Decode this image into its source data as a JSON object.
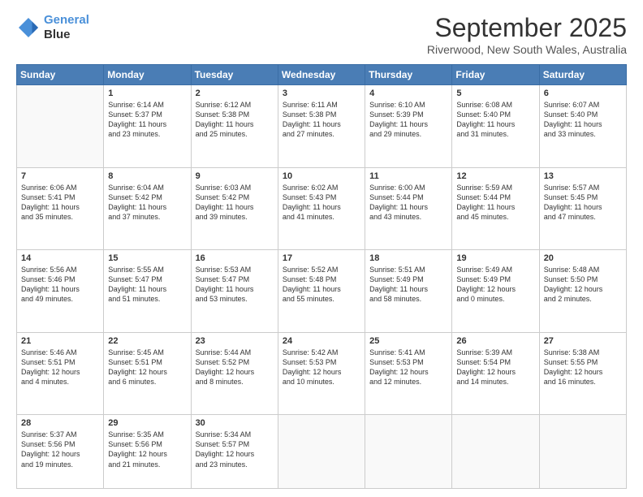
{
  "logo": {
    "line1": "General",
    "line2": "Blue"
  },
  "title": "September 2025",
  "subtitle": "Riverwood, New South Wales, Australia",
  "days_header": [
    "Sunday",
    "Monday",
    "Tuesday",
    "Wednesday",
    "Thursday",
    "Friday",
    "Saturday"
  ],
  "weeks": [
    [
      {
        "day": "",
        "content": ""
      },
      {
        "day": "1",
        "content": "Sunrise: 6:14 AM\nSunset: 5:37 PM\nDaylight: 11 hours\nand 23 minutes."
      },
      {
        "day": "2",
        "content": "Sunrise: 6:12 AM\nSunset: 5:38 PM\nDaylight: 11 hours\nand 25 minutes."
      },
      {
        "day": "3",
        "content": "Sunrise: 6:11 AM\nSunset: 5:38 PM\nDaylight: 11 hours\nand 27 minutes."
      },
      {
        "day": "4",
        "content": "Sunrise: 6:10 AM\nSunset: 5:39 PM\nDaylight: 11 hours\nand 29 minutes."
      },
      {
        "day": "5",
        "content": "Sunrise: 6:08 AM\nSunset: 5:40 PM\nDaylight: 11 hours\nand 31 minutes."
      },
      {
        "day": "6",
        "content": "Sunrise: 6:07 AM\nSunset: 5:40 PM\nDaylight: 11 hours\nand 33 minutes."
      }
    ],
    [
      {
        "day": "7",
        "content": "Sunrise: 6:06 AM\nSunset: 5:41 PM\nDaylight: 11 hours\nand 35 minutes."
      },
      {
        "day": "8",
        "content": "Sunrise: 6:04 AM\nSunset: 5:42 PM\nDaylight: 11 hours\nand 37 minutes."
      },
      {
        "day": "9",
        "content": "Sunrise: 6:03 AM\nSunset: 5:42 PM\nDaylight: 11 hours\nand 39 minutes."
      },
      {
        "day": "10",
        "content": "Sunrise: 6:02 AM\nSunset: 5:43 PM\nDaylight: 11 hours\nand 41 minutes."
      },
      {
        "day": "11",
        "content": "Sunrise: 6:00 AM\nSunset: 5:44 PM\nDaylight: 11 hours\nand 43 minutes."
      },
      {
        "day": "12",
        "content": "Sunrise: 5:59 AM\nSunset: 5:44 PM\nDaylight: 11 hours\nand 45 minutes."
      },
      {
        "day": "13",
        "content": "Sunrise: 5:57 AM\nSunset: 5:45 PM\nDaylight: 11 hours\nand 47 minutes."
      }
    ],
    [
      {
        "day": "14",
        "content": "Sunrise: 5:56 AM\nSunset: 5:46 PM\nDaylight: 11 hours\nand 49 minutes."
      },
      {
        "day": "15",
        "content": "Sunrise: 5:55 AM\nSunset: 5:47 PM\nDaylight: 11 hours\nand 51 minutes."
      },
      {
        "day": "16",
        "content": "Sunrise: 5:53 AM\nSunset: 5:47 PM\nDaylight: 11 hours\nand 53 minutes."
      },
      {
        "day": "17",
        "content": "Sunrise: 5:52 AM\nSunset: 5:48 PM\nDaylight: 11 hours\nand 55 minutes."
      },
      {
        "day": "18",
        "content": "Sunrise: 5:51 AM\nSunset: 5:49 PM\nDaylight: 11 hours\nand 58 minutes."
      },
      {
        "day": "19",
        "content": "Sunrise: 5:49 AM\nSunset: 5:49 PM\nDaylight: 12 hours\nand 0 minutes."
      },
      {
        "day": "20",
        "content": "Sunrise: 5:48 AM\nSunset: 5:50 PM\nDaylight: 12 hours\nand 2 minutes."
      }
    ],
    [
      {
        "day": "21",
        "content": "Sunrise: 5:46 AM\nSunset: 5:51 PM\nDaylight: 12 hours\nand 4 minutes."
      },
      {
        "day": "22",
        "content": "Sunrise: 5:45 AM\nSunset: 5:51 PM\nDaylight: 12 hours\nand 6 minutes."
      },
      {
        "day": "23",
        "content": "Sunrise: 5:44 AM\nSunset: 5:52 PM\nDaylight: 12 hours\nand 8 minutes."
      },
      {
        "day": "24",
        "content": "Sunrise: 5:42 AM\nSunset: 5:53 PM\nDaylight: 12 hours\nand 10 minutes."
      },
      {
        "day": "25",
        "content": "Sunrise: 5:41 AM\nSunset: 5:53 PM\nDaylight: 12 hours\nand 12 minutes."
      },
      {
        "day": "26",
        "content": "Sunrise: 5:39 AM\nSunset: 5:54 PM\nDaylight: 12 hours\nand 14 minutes."
      },
      {
        "day": "27",
        "content": "Sunrise: 5:38 AM\nSunset: 5:55 PM\nDaylight: 12 hours\nand 16 minutes."
      }
    ],
    [
      {
        "day": "28",
        "content": "Sunrise: 5:37 AM\nSunset: 5:56 PM\nDaylight: 12 hours\nand 19 minutes."
      },
      {
        "day": "29",
        "content": "Sunrise: 5:35 AM\nSunset: 5:56 PM\nDaylight: 12 hours\nand 21 minutes."
      },
      {
        "day": "30",
        "content": "Sunrise: 5:34 AM\nSunset: 5:57 PM\nDaylight: 12 hours\nand 23 minutes."
      },
      {
        "day": "",
        "content": ""
      },
      {
        "day": "",
        "content": ""
      },
      {
        "day": "",
        "content": ""
      },
      {
        "day": "",
        "content": ""
      }
    ]
  ]
}
